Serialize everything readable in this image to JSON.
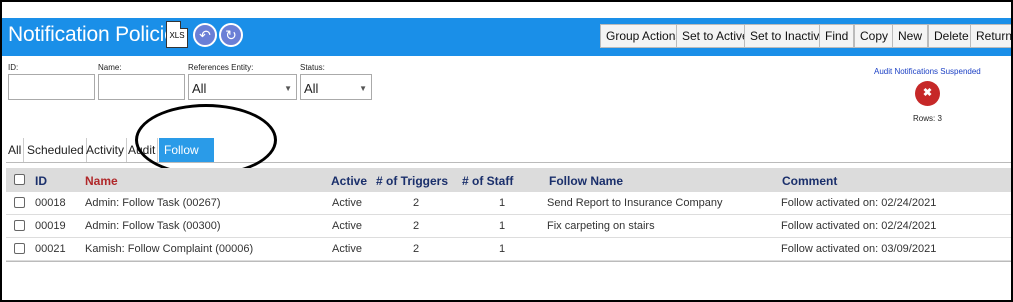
{
  "header": {
    "title": "Notification Policies",
    "xls_label": "XLS",
    "buttons": [
      "Group Actions",
      "Set to Active",
      "Set to Inactive",
      "Find",
      "Copy",
      "New",
      "Delete",
      "Return"
    ]
  },
  "filters": {
    "id_label": "ID:",
    "id_value": "",
    "name_label": "Name:",
    "name_value": "",
    "entity_label": "References Entity:",
    "entity_value": "All",
    "status_label": "Status:",
    "status_value": "All"
  },
  "audit": {
    "link": "Audit Notifications Suspended",
    "rows": "Rows: 3"
  },
  "tabs": [
    "All",
    "Scheduled",
    "Activity",
    "Audit",
    "Follow Updates"
  ],
  "active_tab": "Follow Updates",
  "table": {
    "columns": [
      "ID",
      "Name",
      "Active",
      "# of Triggers",
      "# of Staff",
      "Follow Name",
      "Comment"
    ],
    "rows": [
      {
        "id": "00018",
        "name": "Admin: Follow Task (00267)",
        "active": "Active",
        "triggers": "2",
        "staff": "1",
        "follow_name": "Send Report to Insurance Company",
        "comment": "Follow activated on: 02/24/2021"
      },
      {
        "id": "00019",
        "name": "Admin: Follow Task (00300)",
        "active": "Active",
        "triggers": "2",
        "staff": "1",
        "follow_name": "Fix carpeting on stairs",
        "comment": "Follow activated on: 02/24/2021"
      },
      {
        "id": "00021",
        "name": "Kamish: Follow Complaint (00006)",
        "active": "Active",
        "triggers": "2",
        "staff": "1",
        "follow_name": "",
        "comment": "Follow activated on: 03/09/2021"
      }
    ]
  },
  "colors": {
    "header_bg": "#1a8fe8",
    "active_tab_bg": "#2a9be8",
    "name_header": "#b0282a",
    "column_header": "#1a2f6b",
    "mute_icon": "#c62828"
  },
  "icons": [
    "xls-file-icon",
    "back-arrow-icon",
    "refresh-icon",
    "mute-speaker-icon",
    "dropdown-caret-icon"
  ]
}
